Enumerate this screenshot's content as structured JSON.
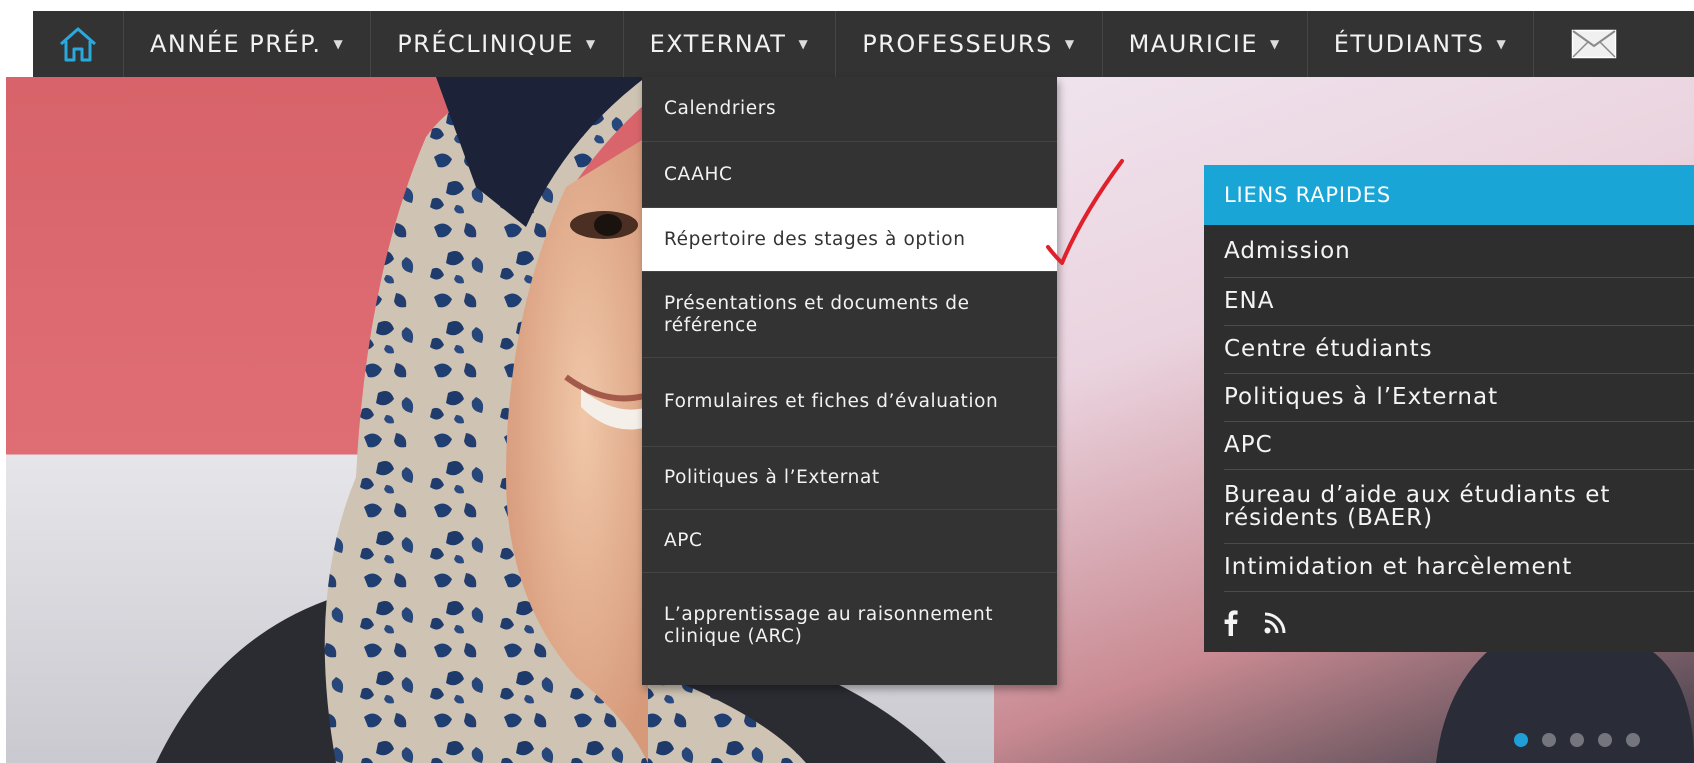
{
  "nav": {
    "items": [
      {
        "label": "ANNÉE PRÉP."
      },
      {
        "label": "PRÉCLINIQUE"
      },
      {
        "label": "EXTERNAT"
      },
      {
        "label": "PROFESSEURS"
      },
      {
        "label": "MAURICIE"
      },
      {
        "label": "ÉTUDIANTS"
      }
    ],
    "caret": "▼"
  },
  "dropdown": {
    "open_menu": "EXTERNAT",
    "items": [
      {
        "label": "Calendriers"
      },
      {
        "label": "CAAHC"
      },
      {
        "label": "Répertoire des stages à option"
      },
      {
        "label": "Présentations et documents de référence"
      },
      {
        "label": "Formulaires et fiches d’évaluation"
      },
      {
        "label": "Politiques à l’Externat"
      },
      {
        "label": "APC"
      },
      {
        "label": "L’apprentissage au raisonnement clinique (ARC)"
      }
    ],
    "active_index": 2
  },
  "quick_links": {
    "title": "LIENS RAPIDES",
    "items": [
      {
        "label": "Admission"
      },
      {
        "label": "ENA"
      },
      {
        "label": "Centre étudiants"
      },
      {
        "label": "Politiques à l’Externat"
      },
      {
        "label": "APC"
      },
      {
        "label": "Bureau d’aide aux étudiants et résidents (BAER)"
      },
      {
        "label": "Intimidation et harcèlement"
      }
    ],
    "social": [
      "facebook-icon",
      "rss-icon"
    ]
  },
  "slider": {
    "slide_count": 5,
    "active_slide": 1
  },
  "colors": {
    "nav_bg": "#333333",
    "accent": "#19a5d6",
    "annotation": "#e0202a"
  }
}
